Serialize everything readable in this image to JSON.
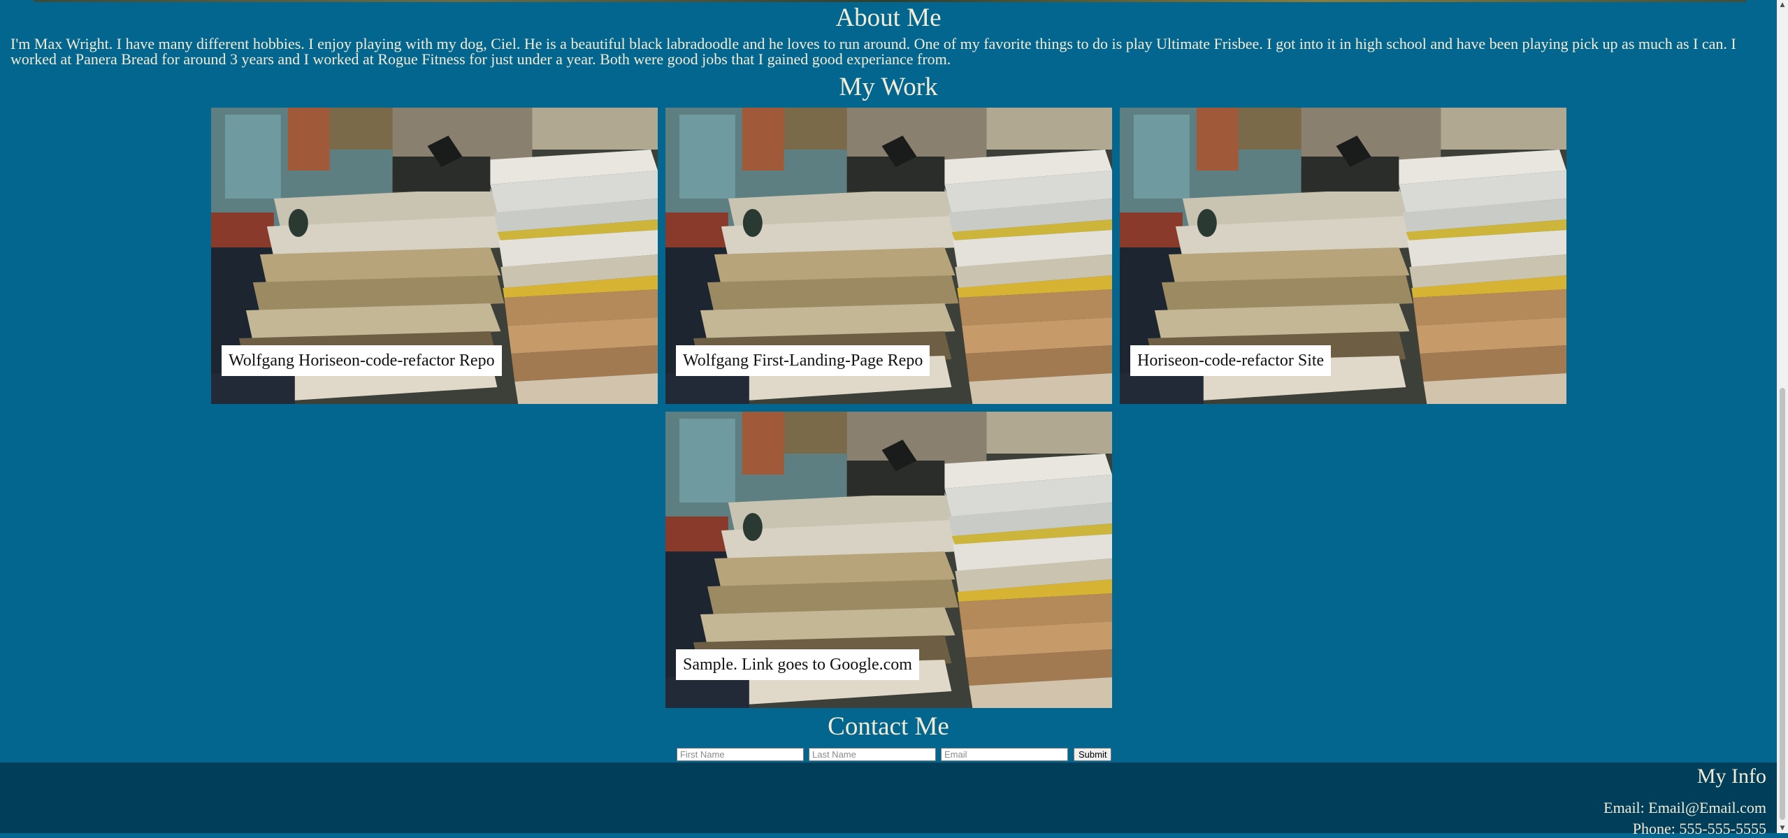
{
  "about": {
    "title": "About Me",
    "text": "I'm Max Wright. I have many different hobbies. I enjoy playing with my dog, Ciel. He is a beautiful black labradoodle and he loves to run around. One of my favorite things to do is play Ultimate Frisbee. I got into it in high school and have been playing pick up as much as I can. I worked at Panera Bread for around 3 years and I worked at Rogue Fitness for just under a year. Both were good jobs that I gained good experiance from."
  },
  "work": {
    "title": "My Work",
    "items": [
      {
        "label": "Wolfgang Horiseon-code-refactor Repo"
      },
      {
        "label": "Wolfgang First-Landing-Page Repo"
      },
      {
        "label": "Horiseon-code-refactor Site"
      },
      {
        "label": "Sample. Link goes to Google.com"
      }
    ]
  },
  "contact": {
    "title": "Contact Me",
    "first_name_placeholder": "First Name",
    "last_name_placeholder": "Last Name",
    "email_placeholder": "Email",
    "submit_label": "Submit"
  },
  "footer": {
    "title": "My Info",
    "email": "Email: Email@Email.com",
    "phone": "Phone: 555-555-5555"
  },
  "colors": {
    "page_background": "#03668f",
    "footer_background": "#003e5a",
    "text": "#f2ecd6"
  },
  "icons": {
    "scroll_up": "triangle-up-icon",
    "scroll_down": "triangle-down-icon"
  }
}
